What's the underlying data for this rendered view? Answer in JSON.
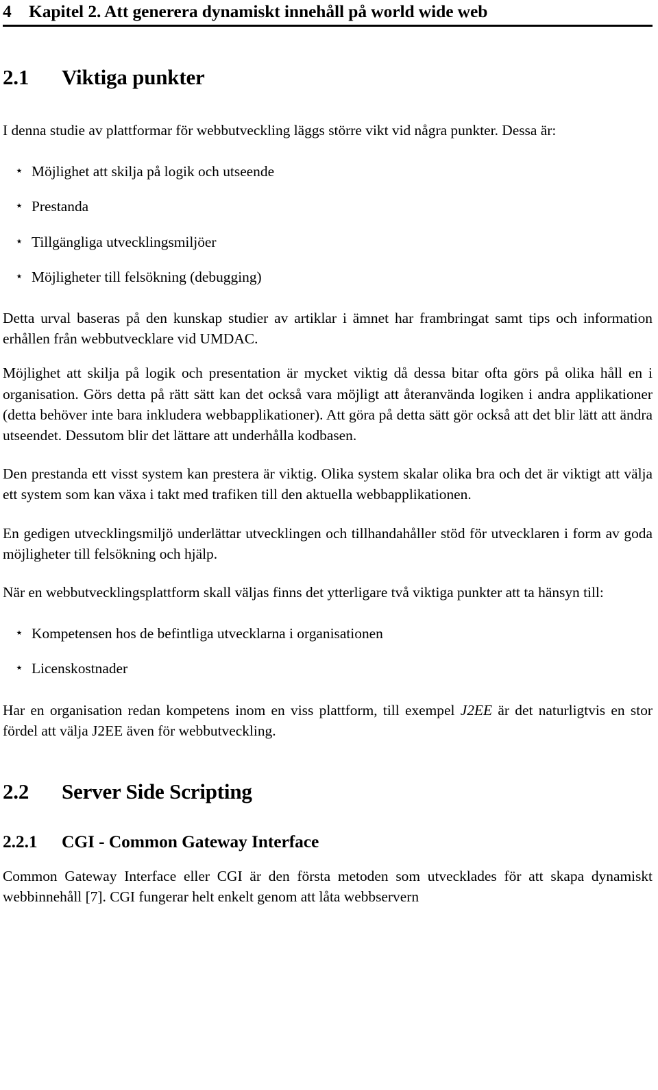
{
  "header": {
    "folio": "4",
    "running_head": "Kapitel 2. Att generera dynamiskt innehåll på world wide web"
  },
  "sections": {
    "s21": {
      "number": "2.1",
      "title": "Viktiga punkter",
      "intro": "I denna studie av plattformar för webbutveckling läggs större vikt vid några punkter. Dessa är:",
      "bullets": [
        {
          "marker": "⋆",
          "text": "Möjlighet att skilja på logik och utseende"
        },
        {
          "marker": "⋆",
          "text": "Prestanda"
        },
        {
          "marker": "⋆",
          "text": "Tillgängliga utvecklingsmiljöer"
        },
        {
          "marker": "⋆",
          "text": "Möjligheter till felsökning (debugging)"
        }
      ],
      "para_source": "Detta urval baseras på den kunskap studier av artiklar i ämnet har frambringat samt tips och information erhållen från webbutvecklare vid UMDAC.",
      "para_logic": "Möjlighet att skilja på logik och presentation är mycket viktig då dessa bitar ofta görs på olika håll en i organisation. Görs detta på rätt sätt kan det också vara möjligt att återanvända logiken i andra applikationer (detta behöver inte bara inkludera webbapplikationer). Att göra på detta sätt gör också att det blir lätt att ändra utseendet. Dessutom blir det lättare att underhålla kodbasen.",
      "para_performance": "Den prestanda ett visst system kan prestera är viktig. Olika system skalar olika bra och det är viktigt att välja ett system som kan växa i takt med trafiken till den aktuella webbapplikationen.",
      "para_devenv": "En gedigen utvecklingsmiljö underlättar utvecklingen och tillhandahåller stöd för utvecklaren i form av goda möjligheter till felsökning och hjälp.",
      "para_platform_intro": "När en webbutvecklingsplattform skall väljas finns det ytterligare två viktiga punkter att ta hänsyn till:",
      "bullets2": [
        {
          "marker": "⋆",
          "text": "Kompetensen hos de befintliga utvecklarna i organisationen"
        },
        {
          "marker": "⋆",
          "text": "Licenskostnader"
        }
      ],
      "para_closing_a": "Har en organisation redan kompetens inom en viss plattform, till exempel ",
      "para_closing_em": "J2EE",
      "para_closing_b": " är det naturligtvis en stor fördel att välja J2EE även för webbutveckling."
    },
    "s22": {
      "number": "2.2",
      "title": "Server Side Scripting"
    },
    "s221": {
      "number": "2.2.1",
      "title": "CGI - Common Gateway Interface",
      "para_cgi": "Common Gateway Interface eller CGI är den första metoden som utvecklades för att skapa dynamiskt webbinnehåll [7]. CGI fungerar helt enkelt genom att låta webbservern"
    }
  }
}
